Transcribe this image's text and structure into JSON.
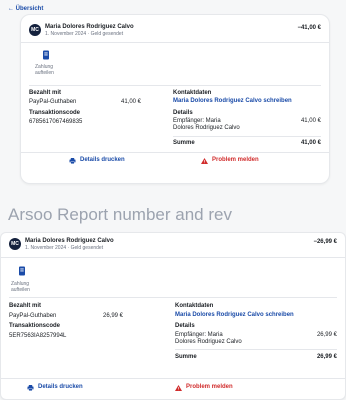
{
  "top": {
    "back_label": "Übersicht",
    "header": {
      "avatar_initials": "MC",
      "name": "Maria Dolores Rodriguez Calvo",
      "subtitle": "1. November 2024 · Geld gesendet",
      "amount": "−41,00 €"
    },
    "action": {
      "icon": "document-icon",
      "label_line1": "Zahlung",
      "label_line2": "aufteilen"
    },
    "paid_with": {
      "label": "Bezahlt mit",
      "method": "PayPal-Guthaben",
      "amount": "41,00 €"
    },
    "transaction": {
      "label": "Transaktionscode",
      "code": "6785617067469835"
    },
    "contact": {
      "label": "Kontaktdaten",
      "link": "Maria Dolores Rodriguez Calvo schreiben"
    },
    "details": {
      "label": "Details",
      "recipient_label_line1": "Empfänger: Maria",
      "recipient_label_line2": "Dolores Rodriguez Calvo",
      "recipient_amount": "41,00 €",
      "sum_label": "Summe",
      "sum_amount": "41,00 €"
    },
    "footer": {
      "print": "Details drucken",
      "report": "Problem melden"
    }
  },
  "caption": "Arsoo   Report number and rev",
  "bottom": {
    "header": {
      "avatar_initials": "MC",
      "name": "Maria Dolores Rodriguez Calvo",
      "subtitle": "1. November 2024 · Geld gesendet",
      "amount": "−26,99 €"
    },
    "action": {
      "icon": "document-icon",
      "label_line1": "Zahlung",
      "label_line2": "aufteilen"
    },
    "paid_with": {
      "label": "Bezahlt mit",
      "method": "PayPal-Guthaben",
      "amount": "26,99 €"
    },
    "transaction": {
      "label": "Transaktionscode",
      "code": "5ER7563IA8257994L"
    },
    "contact": {
      "label": "Kontaktdaten",
      "link": "Maria Dolores Rodriguez Calvo schreiben"
    },
    "details": {
      "label": "Details",
      "recipient_label_line1": "Empfänger: Maria",
      "recipient_label_line2": "Dolores Rodriguez Calvo",
      "recipient_amount": "26,99 €",
      "sum_label": "Summe",
      "sum_amount": "26,99 €"
    },
    "footer": {
      "print": "Details drucken",
      "report": "Problem melden"
    }
  },
  "colors": {
    "brand": "#1a4ba8",
    "avatar": "#14213d",
    "danger": "#d12c2c"
  }
}
